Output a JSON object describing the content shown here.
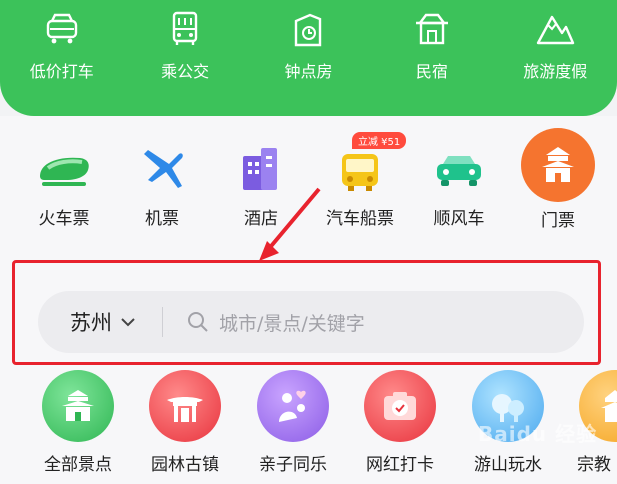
{
  "top_nav": [
    {
      "label": "低价打车",
      "icon": "car-icon"
    },
    {
      "label": "乘公交",
      "icon": "bus-icon"
    },
    {
      "label": "钟点房",
      "icon": "hourly-room-icon"
    },
    {
      "label": "民宿",
      "icon": "homestay-icon"
    },
    {
      "label": "旅游度假",
      "icon": "mountain-icon"
    }
  ],
  "services": [
    {
      "label": "火车票",
      "icon": "train-icon"
    },
    {
      "label": "机票",
      "icon": "airplane-icon"
    },
    {
      "label": "酒店",
      "icon": "hotel-icon"
    },
    {
      "label": "汽车船票",
      "icon": "coach-icon",
      "badge": "立减 ¥51"
    },
    {
      "label": "顺风车",
      "icon": "carpool-icon"
    },
    {
      "label": "门票",
      "icon": "ticket-temple-icon"
    }
  ],
  "search": {
    "city": "苏州",
    "placeholder": "城市/景点/关键字"
  },
  "categories": [
    {
      "label": "全部景点",
      "icon": "all-attractions-icon"
    },
    {
      "label": "园林古镇",
      "icon": "garden-town-icon"
    },
    {
      "label": "亲子同乐",
      "icon": "family-icon"
    },
    {
      "label": "网红打卡",
      "icon": "camera-checkin-icon"
    },
    {
      "label": "游山玩水",
      "icon": "landscape-icon"
    },
    {
      "label": "宗教",
      "icon": "religion-icon"
    }
  ],
  "colors": {
    "brand_green": "#3cc25a",
    "highlight_red": "#e8232e"
  },
  "watermark": "Baidu 经验"
}
